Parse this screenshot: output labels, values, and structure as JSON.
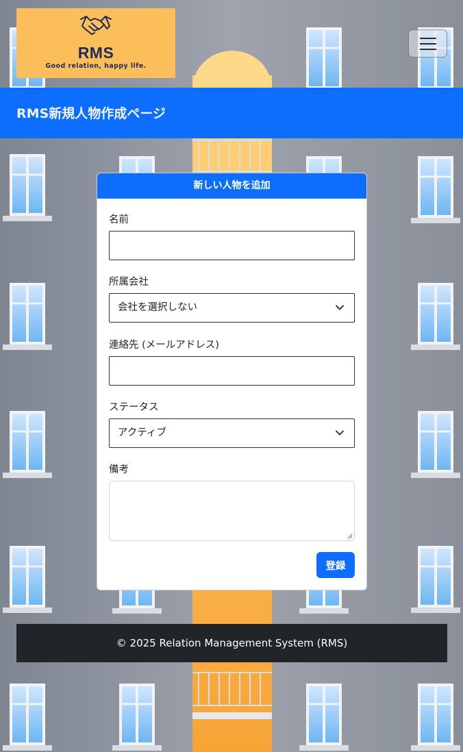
{
  "brand": {
    "title": "RMS",
    "tagline": "Good relation, happy life.",
    "icon": "handshake-icon",
    "color": "#fcbe5a"
  },
  "nav": {
    "menu_icon": "hamburger-menu-icon"
  },
  "header": {
    "title": "RMS新規人物作成ページ",
    "color": "#0d6efd"
  },
  "form": {
    "title": "新しい人物を追加",
    "fields": {
      "name": {
        "label": "名前",
        "value": ""
      },
      "company": {
        "label": "所属会社",
        "selected": "会社を選択しない"
      },
      "contact": {
        "label": "連絡先 (メールアドレス)",
        "value": ""
      },
      "status": {
        "label": "ステータス",
        "selected": "アクティブ"
      },
      "notes": {
        "label": "備考",
        "value": ""
      }
    },
    "submit_label": "登録"
  },
  "footer": {
    "text": "© 2025 Relation Management System (RMS)"
  }
}
